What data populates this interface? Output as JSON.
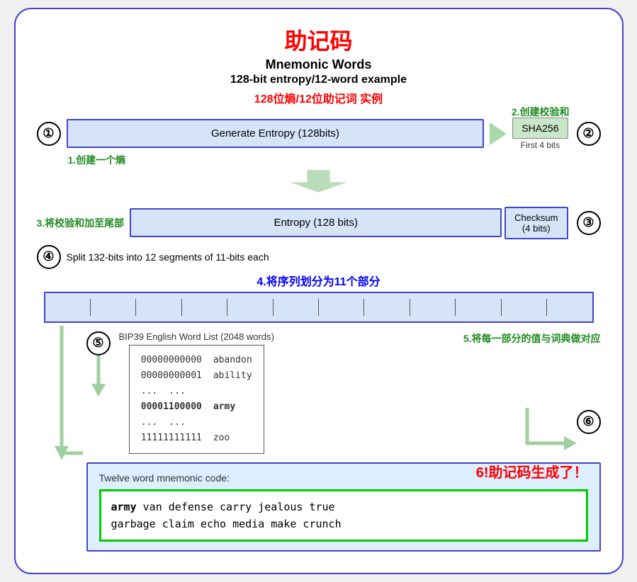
{
  "title": {
    "zh": "助记码",
    "en_main": "Mnemonic Words",
    "en_sub": "128-bit entropy/12-word example",
    "zh_sub": "128位熵/12位助记词 实例"
  },
  "steps": {
    "step1": {
      "circle": "①",
      "label": "Generate Entropy (128bits)",
      "zh_label": "1.创建一个熵"
    },
    "step2": {
      "circle": "②",
      "label": "SHA256",
      "sublabel": "First 4 bits",
      "zh_label": "2.创建校验和"
    },
    "step3": {
      "circle": "③",
      "zh_label": "3.将校验和加至尾部",
      "entropy_label": "Entropy (128 bits)",
      "checksum_label": "Checksum\n(4 bits)"
    },
    "step4": {
      "circle": "④",
      "label": "Split 132-bits into 12 segments of 11-bits each",
      "zh_label": "4.将序列划分为11个部分"
    },
    "step5": {
      "circle": "⑤",
      "bip39_label": "BIP39 English Word List (2048 words)",
      "zh_label": "5.将每一部分的值与词典做对应",
      "wordlist": [
        {
          "bits": "00000000000",
          "word": "abandon"
        },
        {
          "bits": "00000000001",
          "word": "ability"
        },
        {
          "bits": "...",
          "word": "..."
        },
        {
          "bits": "00001100000",
          "word": "army"
        },
        {
          "bits": "...",
          "word": "..."
        },
        {
          "bits": "11111111111",
          "word": "zoo"
        }
      ]
    },
    "step6": {
      "circle": "⑥",
      "zh_label": "6!助记码生成了！",
      "mnemonic_label": "Twelve word mnemonic code:",
      "mnemonic": "army van defense carry jealous true garbage claim echo media make crunch",
      "first_word": "army"
    }
  }
}
